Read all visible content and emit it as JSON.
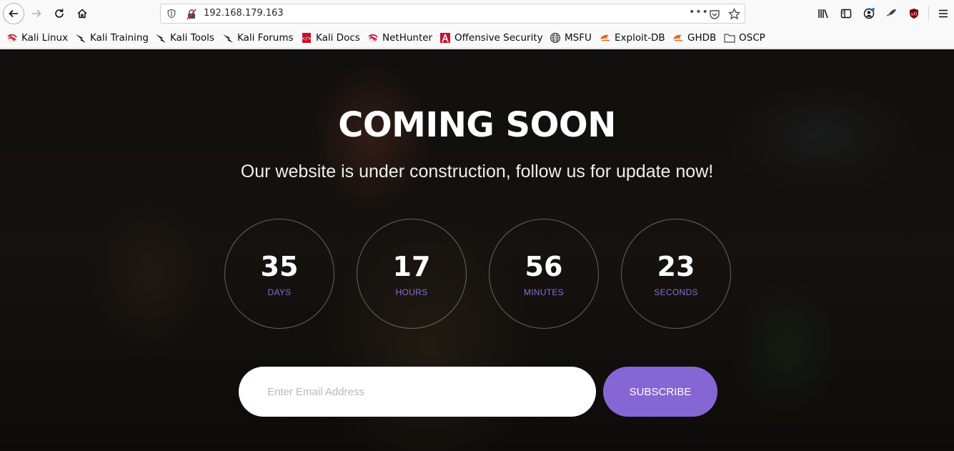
{
  "browser": {
    "url": "192.168.179.163",
    "bookmarks": [
      {
        "label": "Kali Linux",
        "icon": "kali-dragon-icon"
      },
      {
        "label": "Kali Training",
        "icon": "kali-training-icon"
      },
      {
        "label": "Kali Tools",
        "icon": "kali-tools-icon"
      },
      {
        "label": "Kali Forums",
        "icon": "kali-forums-icon"
      },
      {
        "label": "Kali Docs",
        "icon": "kali-docs-icon"
      },
      {
        "label": "NetHunter",
        "icon": "nethunter-icon"
      },
      {
        "label": "Offensive Security",
        "icon": "offsec-icon"
      },
      {
        "label": "MSFU",
        "icon": "globe-icon"
      },
      {
        "label": "Exploit-DB",
        "icon": "exploitdb-icon"
      },
      {
        "label": "GHDB",
        "icon": "ghdb-icon"
      },
      {
        "label": "OSCP",
        "icon": "folder-icon"
      }
    ]
  },
  "page": {
    "title": "COMING SOON",
    "subtitle": "Our website is under construction, follow us for update now!",
    "countdown": [
      {
        "value": "35",
        "label": "DAYS"
      },
      {
        "value": "17",
        "label": "HOURS"
      },
      {
        "value": "56",
        "label": "MINUTES"
      },
      {
        "value": "23",
        "label": "SECONDS"
      }
    ],
    "email_placeholder": "Enter Email Address",
    "subscribe_label": "SUBSCRIBE",
    "accent_color": "#8665d4"
  }
}
